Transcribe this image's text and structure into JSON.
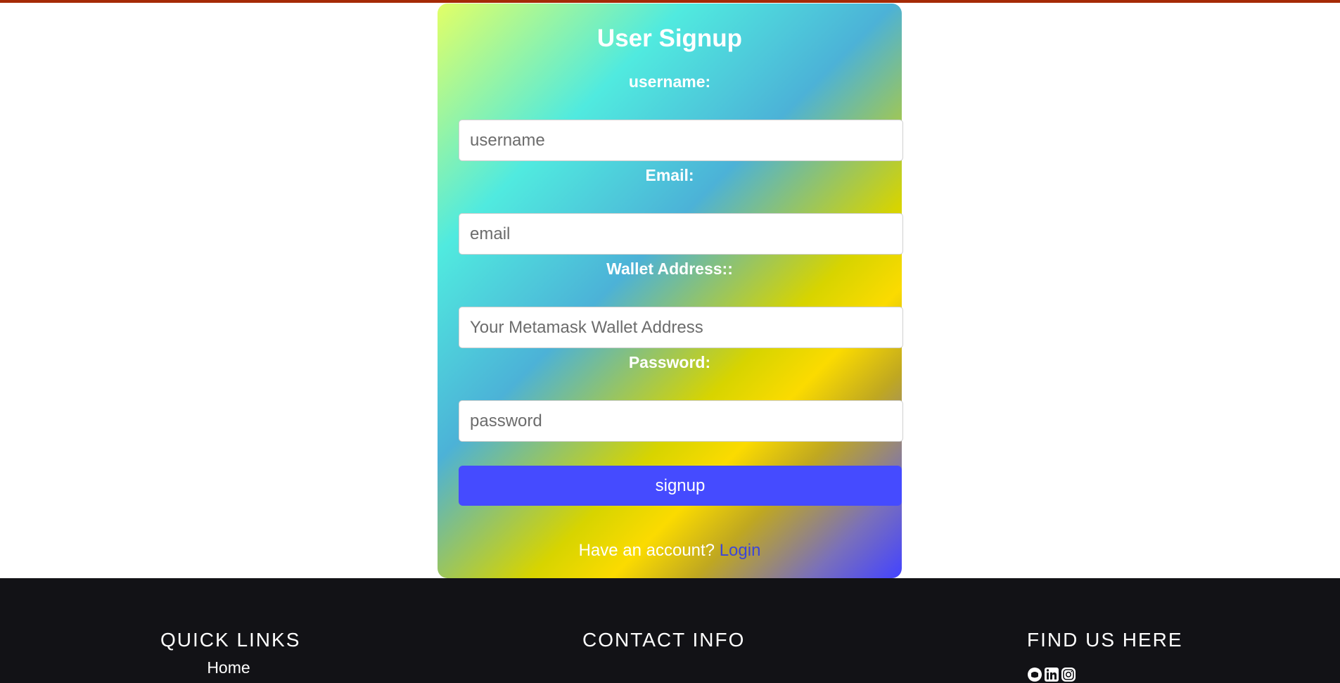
{
  "form": {
    "title": "User Signup",
    "username": {
      "label": "username:",
      "placeholder": "username"
    },
    "email": {
      "label": "Email:",
      "placeholder": "email"
    },
    "wallet": {
      "label": "Wallet Address::",
      "placeholder": "Your Metamask Wallet Address"
    },
    "password": {
      "label": "Password:",
      "placeholder": "password"
    },
    "submit_label": "signup",
    "account_prompt": "Have an account?",
    "login_label": "Login"
  },
  "footer": {
    "quick_links": {
      "heading": "QUICK LINKS",
      "items": [
        "Home"
      ]
    },
    "contact": {
      "heading": "CONTACT INFO"
    },
    "find_us": {
      "heading": "FIND US HERE",
      "icons": [
        "github-icon",
        "linkedin-icon",
        "instagram-icon"
      ]
    }
  },
  "colors": {
    "top_bar": "#a52a06",
    "button": "#454bff",
    "link": "#3d46d6",
    "footer_bg": "#121216",
    "card_gradient": [
      "#e2ff66",
      "#50eadf",
      "#4cb2d7",
      "#d7d400",
      "#fbdb00",
      "#7a70ba",
      "#4343ff"
    ]
  }
}
